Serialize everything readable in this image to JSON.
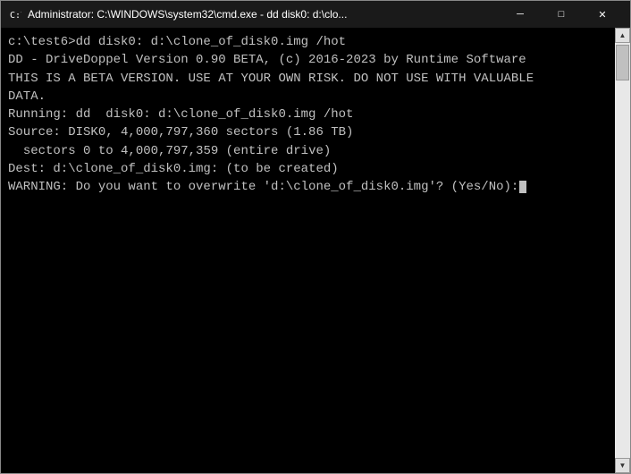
{
  "window": {
    "title": "Administrator: C:\\WINDOWS\\system32\\cmd.exe - dd  disk0: d:\\clo...",
    "minimize_label": "─",
    "maximize_label": "□",
    "close_label": "✕"
  },
  "terminal": {
    "lines": [
      "c:\\test6>dd disk0: d:\\clone_of_disk0.img /hot",
      "DD - DriveDoppel Version 0.90 BETA, (c) 2016-2023 by Runtime Software",
      "THIS IS A BETA VERSION. USE AT YOUR OWN RISK. DO NOT USE WITH VALUABLE",
      "DATA.",
      "Running: dd  disk0: d:\\clone_of_disk0.img /hot",
      "Source: DISK0, 4,000,797,360 sectors (1.86 TB)",
      "  sectors 0 to 4,000,797,359 (entire drive)",
      "Dest: d:\\clone_of_disk0.img: (to be created)",
      "WARNING: Do you want to overwrite 'd:\\clone_of_disk0.img'? (Yes/No):"
    ]
  }
}
